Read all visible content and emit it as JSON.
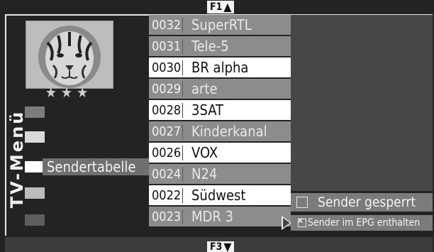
{
  "keys": {
    "top": "F1",
    "bottom": "F3"
  },
  "menu_title": "TV-Menü",
  "rating_stars": "★★★",
  "selected_menu_label": "Sendertabelle",
  "channels": [
    {
      "num": "0032",
      "name": "SuperRTL",
      "style": "gray"
    },
    {
      "num": "0031",
      "name": "Tele-5",
      "style": "gray"
    },
    {
      "num": "0030",
      "name": "BR alpha",
      "style": "white"
    },
    {
      "num": "0029",
      "name": "arte",
      "style": "gray"
    },
    {
      "num": "0028",
      "name": "3SAT",
      "style": "white"
    },
    {
      "num": "0027",
      "name": "Kinderkanal",
      "style": "gray"
    },
    {
      "num": "0026",
      "name": "VOX",
      "style": "white"
    },
    {
      "num": "0024",
      "name": "N24",
      "style": "gray"
    },
    {
      "num": "0022",
      "name": "Südwest",
      "style": "white"
    },
    {
      "num": "0023",
      "name": "MDR 3",
      "style": "gray"
    }
  ],
  "options": {
    "blocked": {
      "label": "Sender gesperrt",
      "checked": false
    },
    "epg": {
      "label": "Sender im EPG enthalten",
      "checked": true
    }
  },
  "colors": {
    "background": "#232323",
    "row_gray": "#8c8c8c",
    "row_white": "#ffffff",
    "panel": "#474747"
  }
}
